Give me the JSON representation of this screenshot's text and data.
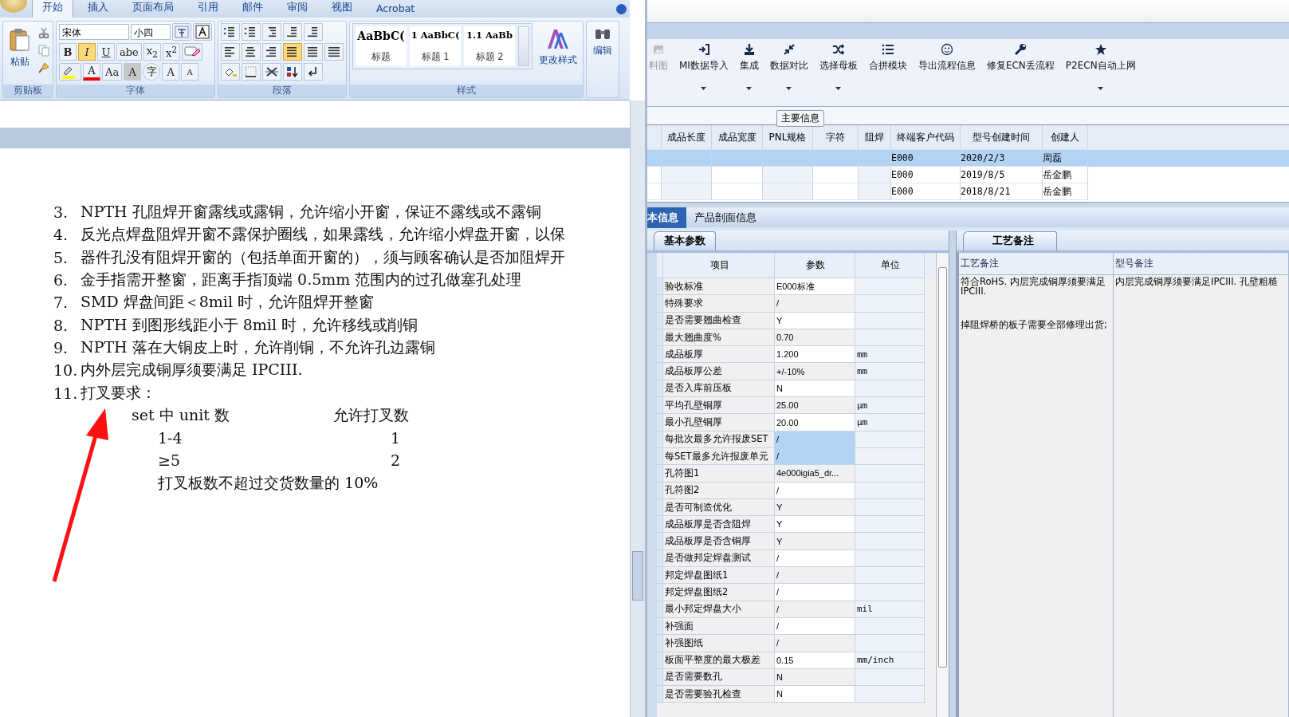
{
  "word": {
    "tabs": [
      {
        "label": "开始",
        "selected": true
      },
      {
        "label": "插入",
        "selected": false
      },
      {
        "label": "页面布局",
        "selected": false
      },
      {
        "label": "引用",
        "selected": false
      },
      {
        "label": "邮件",
        "selected": false
      },
      {
        "label": "审阅",
        "selected": false
      },
      {
        "label": "视图",
        "selected": false
      },
      {
        "label": "Acrobat",
        "selected": false
      }
    ],
    "ribbon": {
      "clipboard": {
        "paste": "粘贴",
        "group": "剪贴板"
      },
      "font": {
        "group": "字体",
        "name": "宋体",
        "size": "小四",
        "buttons": [
          {
            "label": "B",
            "on": false
          },
          {
            "label": "I",
            "on": true
          },
          {
            "label": "U",
            "on": false
          },
          {
            "label": "abe",
            "on": false
          },
          {
            "label": "x$_{2}$",
            "on": false
          },
          {
            "label": "x$^{2}$",
            "on": false
          }
        ],
        "case": "Aa",
        "shade": "A",
        "enclose": "字",
        "grow": "A",
        "shrink": "A",
        "text_color_letter": "A"
      },
      "paragraph": {
        "group": "段落",
        "rows": [
          [
            {
              "kind": "bullets",
              "on": false
            },
            {
              "kind": "numbering",
              "on": false
            },
            {
              "kind": "multilevel",
              "on": false
            },
            {
              "kind": "outdent",
              "on": false
            },
            {
              "kind": "indent",
              "on": false
            }
          ],
          [
            {
              "kind": "left",
              "on": false
            },
            {
              "kind": "center",
              "on": false
            },
            {
              "kind": "right",
              "on": false
            },
            {
              "kind": "justify",
              "on": true
            },
            {
              "kind": "distributed",
              "on": false
            },
            {
              "kind": "spacing",
              "on": false
            }
          ],
          [
            {
              "kind": "shading",
              "on": false
            },
            {
              "kind": "border",
              "on": false
            },
            {
              "kind": "asian",
              "on": false
            },
            {
              "kind": "sort",
              "on": false
            },
            {
              "kind": "marks",
              "on": false
            }
          ]
        ]
      },
      "styles": {
        "group": "样式",
        "items": [
          {
            "sample": "AaBbC(",
            "name": "标题"
          },
          {
            "sample": "1  AaBbC(",
            "name": "标题 1"
          },
          {
            "sample": "1.1  AaBb",
            "name": "标题 2"
          }
        ],
        "change": "更改样式"
      },
      "editing": {
        "label": "编辑"
      }
    },
    "document": {
      "items": [
        {
          "number": "3.",
          "text": "NPTH 孔阻焊开窗露线或露铜，允许缩小开窗，保证不露线或不露铜"
        },
        {
          "number": "4.",
          "text": "反光点焊盘阻焊开窗不露保护圈线，如果露线，允许缩小焊盘开窗，以保"
        },
        {
          "number": "5.",
          "text": "器件孔没有阻焊开窗的（包括单面开窗的），须与顾客确认是否加阻焊开"
        },
        {
          "number": "6.",
          "text": "金手指需开整窗，距离手指顶端 0.5mm 范围内的过孔做塞孔处理"
        },
        {
          "number": "7.",
          "text": "SMD 焊盘间距＜8mil 时，允许阻焊开整窗"
        },
        {
          "number": "8.",
          "text": "NPTH 到图形线距小于 8mil 时，允许移线或削铜"
        },
        {
          "number": "9.",
          "text": "NPTH 落在大铜皮上时，允许削铜，不允许孔边露铜"
        },
        {
          "number": "10.",
          "text": "内外层完成铜厚须要满足 IPCIII."
        },
        {
          "number": "11.",
          "text": "打叉要求："
        }
      ],
      "table": {
        "header": [
          "set 中 unit 数",
          "允许打叉数"
        ],
        "rows": [
          [
            "1-4",
            "1"
          ],
          [
            "≥5",
            "2"
          ]
        ],
        "note": "打叉板数不超过交货数量的 10%"
      }
    }
  },
  "erp": {
    "toolbar": [
      {
        "label": "料图",
        "kind": "image",
        "dropdown": false,
        "disabled": true
      },
      {
        "label": "MI数据导入",
        "kind": "import",
        "dropdown": true,
        "disabled": false
      },
      {
        "label": "集成",
        "kind": "download",
        "dropdown": true,
        "disabled": false
      },
      {
        "label": "数据对比",
        "kind": "compress",
        "dropdown": true,
        "disabled": false
      },
      {
        "label": "选择母板",
        "kind": "shuffle",
        "dropdown": true,
        "disabled": false
      },
      {
        "label": "合拼模块",
        "kind": "list",
        "dropdown": false,
        "disabled": false
      },
      {
        "label": "导出流程信息",
        "kind": "smile",
        "dropdown": false,
        "disabled": false
      },
      {
        "label": "修复ECN丢流程",
        "kind": "wrench",
        "dropdown": false,
        "disabled": false
      },
      {
        "label": "P2ECN自动上网",
        "kind": "star",
        "dropdown": true,
        "disabled": false
      }
    ],
    "main_group": "主要信息",
    "main_table": {
      "columns": [
        "成品长度",
        "成品宽度",
        "PNL规格",
        "字符",
        "阻焊",
        "终端客户代码",
        "型号创建时间",
        "创建人"
      ],
      "rows": [
        {
          "selected": true,
          "customer_code": "E000",
          "created": "2020/2/3",
          "creator": "周磊"
        },
        {
          "selected": false,
          "customer_code": "E000",
          "created": "2019/8/5",
          "creator": "岳金鹏"
        },
        {
          "selected": false,
          "customer_code": "E000",
          "created": "2018/8/21",
          "creator": "岳金鹏"
        }
      ]
    },
    "tabs": [
      {
        "label": "本信息",
        "selected": true
      },
      {
        "label": "产品剖面信息",
        "selected": false
      }
    ],
    "params": {
      "tab": "基本参数",
      "columns": [
        "项目",
        "参数",
        "单位"
      ],
      "rows": [
        {
          "item": "验收标准",
          "value": "E000标准",
          "selected": false
        },
        {
          "item": "特殊要求",
          "value": "/",
          "selected": false
        },
        {
          "item": "是否需要翘曲检查",
          "value": "Y",
          "selected": false
        },
        {
          "item": "最大翘曲度%",
          "value": "0.70",
          "selected": false
        },
        {
          "item": "成品板厚",
          "value": "1.200",
          "unit": "mm",
          "selected": false
        },
        {
          "item": "成品板厚公差",
          "value": "+/-10%",
          "unit": "mm",
          "selected": false
        },
        {
          "item": "是否入库前压板",
          "value": "N",
          "selected": false
        },
        {
          "item": "平均孔壁铜厚",
          "value": "25.00",
          "unit": "μm",
          "selected": false
        },
        {
          "item": "最小孔壁铜厚",
          "value": "20.00",
          "unit": "μm",
          "selected": false
        },
        {
          "item": "每批次最多允许报废SET",
          "value": "/",
          "selected": true
        },
        {
          "item": "每SET最多允许报废单元",
          "value": "/",
          "selected": true
        },
        {
          "item": "孔符图1",
          "value": "4e000igia5_dr...",
          "selected": false
        },
        {
          "item": "孔符图2",
          "value": "/",
          "selected": false
        },
        {
          "item": "是否可制造优化",
          "value": "Y",
          "selected": false
        },
        {
          "item": "成品板厚是否含阻焊",
          "value": "Y",
          "selected": false
        },
        {
          "item": "成品板厚是否含铜厚",
          "value": "Y",
          "selected": false
        },
        {
          "item": "是否做邦定焊盘测试",
          "value": "/",
          "selected": false
        },
        {
          "item": "邦定焊盘图纸1",
          "value": "/",
          "selected": false
        },
        {
          "item": "邦定焊盘图纸2",
          "value": "/",
          "selected": false
        },
        {
          "item": "最小邦定焊盘大小",
          "value": "/",
          "unit": "mil",
          "selected": false
        },
        {
          "item": "补强面",
          "value": "/",
          "selected": false
        },
        {
          "item": "补强图纸",
          "value": "/",
          "selected": false
        },
        {
          "item": "板面平整度的最大极差",
          "value": "0.15",
          "unit": "mm/inch",
          "selected": false
        },
        {
          "item": "是否需要数孔",
          "value": "N",
          "selected": false
        },
        {
          "item": "是否需要验孔检查",
          "value": "N",
          "selected": false
        }
      ]
    },
    "notes": {
      "tab": "工艺备注",
      "columns": [
        "工艺备注",
        "型号备注"
      ],
      "process_notes": [
        "符合RoHS. 内层完成铜厚须要满足IPCIII.",
        "掉阻焊桥的板子需要全部修理出货;"
      ],
      "model_note": "内层完成铜厚须要满足IPCIII. 孔壁粗糙"
    }
  }
}
